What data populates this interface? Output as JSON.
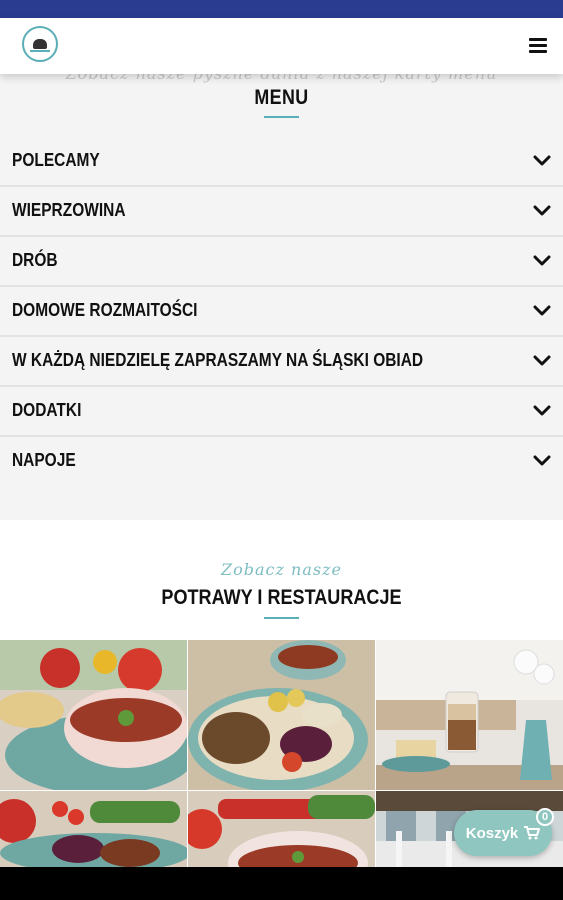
{
  "header": {
    "logo_alt": "logo"
  },
  "menu": {
    "script_text": "Zobacz nasze pyszne dania z naszej karty menu",
    "title": "MENU",
    "items": [
      {
        "label": "POLECAMY"
      },
      {
        "label": "WIEPRZOWINA"
      },
      {
        "label": "DRÓB"
      },
      {
        "label": "DOMOWE ROZMAITOŚCI"
      },
      {
        "label": "W KAŻDĄ NIEDZIELĘ ZAPRASZAMY NA ŚLĄSKI OBIAD"
      },
      {
        "label": "DODATKI"
      },
      {
        "label": "NAPOJE"
      }
    ]
  },
  "dishes": {
    "script_title": "Zobacz nasze",
    "title": "POTRAWY I RESTAURACJE"
  },
  "cart": {
    "label": "Koszyk",
    "count": "0",
    "icon": "cart-icon"
  },
  "colors": {
    "status_bar": "#2a3c8f",
    "accent": "#5aaeb5",
    "cart": "#8fc6bf"
  }
}
